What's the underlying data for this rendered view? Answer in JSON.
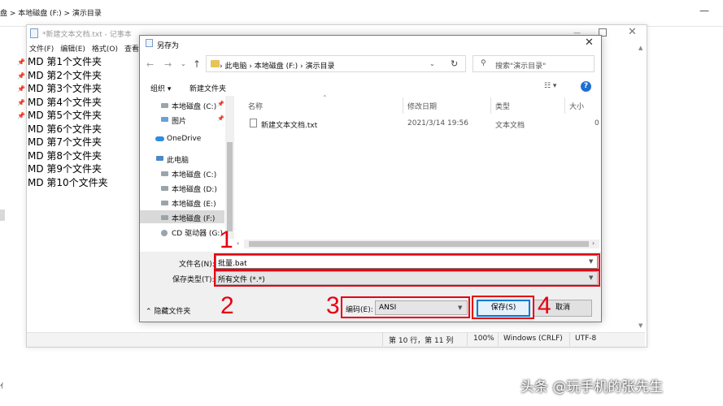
{
  "background": {
    "path_text": "盘  >  本地磁盘 (F:)  >  演示目录",
    "close_glyph": "—",
    "bottom_fragment": "亻"
  },
  "notepad": {
    "title": "*新建文本文档.txt - 记事本",
    "menu": [
      "文件(F)",
      "编辑(E)",
      "格式(O)",
      "查看("
    ],
    "lines": [
      "MD 第1个文件夹",
      "MD 第2个文件夹",
      "MD 第3个文件夹",
      "MD 第4个文件夹",
      "MD 第5个文件夹",
      "MD 第6个文件夹",
      "MD 第7个文件夹",
      "MD 第8个文件夹",
      "MD 第9个文件夹",
      "MD 第10个文件夹"
    ],
    "status": {
      "position": "第 10 行，第 11 列",
      "zoom": "100%",
      "line_ending": "Windows (CRLF)",
      "encoding": "UTF-8"
    }
  },
  "dialog": {
    "title": "另存为",
    "address": "›  此电脑  ›  本地磁盘 (F:)  ›  演示目录",
    "search_placeholder": "搜索\"演示目录\"",
    "toolbar": {
      "organize": "组织 ▾",
      "new_folder": "新建文件夹"
    },
    "nav": [
      {
        "label": "本地磁盘 (C:)",
        "icon": "drive-icon"
      },
      {
        "label": "图片",
        "icon": "pictures-icon"
      },
      {
        "label": "OneDrive",
        "icon": "cloud-icon"
      },
      {
        "label": "此电脑",
        "icon": "computer-icon"
      },
      {
        "label": "本地磁盘 (C:)",
        "icon": "drive-icon"
      },
      {
        "label": "本地磁盘 (D:)",
        "icon": "drive-icon"
      },
      {
        "label": "本地磁盘 (E:)",
        "icon": "drive-icon"
      },
      {
        "label": "本地磁盘 (F:)",
        "icon": "drive-icon"
      },
      {
        "label": "CD 驱动器 (G:)",
        "icon": "cd-drive-icon"
      }
    ],
    "columns": [
      "名称",
      "修改日期",
      "类型",
      "大小"
    ],
    "files": [
      {
        "name": "新建文本文档.txt",
        "modified": "2021/3/14 19:56",
        "type": "文本文档",
        "size": "0"
      }
    ],
    "filename_label": "文件名(N):",
    "filename_value": "批量.bat",
    "filetype_label": "保存类型(T):",
    "filetype_value": "所有文件  (*.*)",
    "hide_folders": "隐藏文件夹",
    "encoding_label": "编码(E):",
    "encoding_value": "ANSI",
    "save": "保存(S)",
    "cancel": "取消"
  },
  "annotations": [
    "1",
    "2",
    "3",
    "4"
  ],
  "watermark": "头条 @玩手机的张先生",
  "colors": {
    "annotation": "#e60012",
    "accent": "#0078d7",
    "folder": "#e8c25b"
  }
}
